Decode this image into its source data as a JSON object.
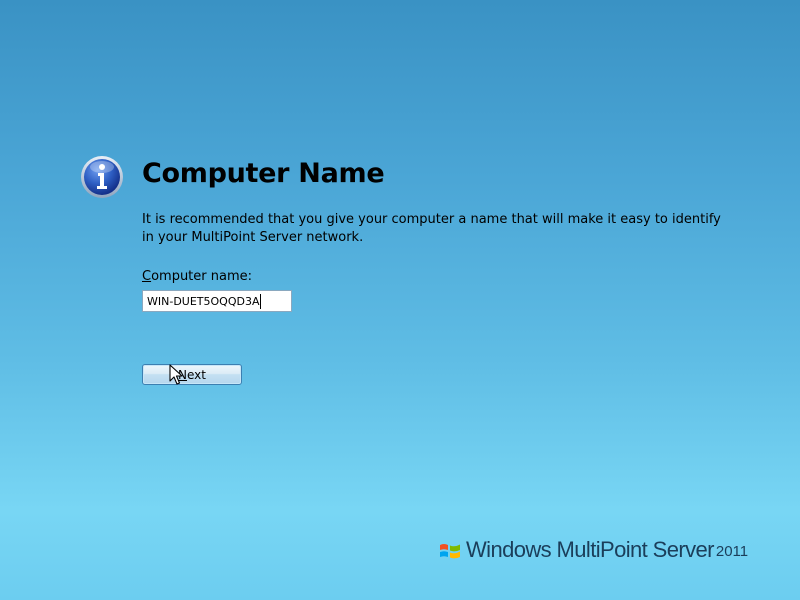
{
  "header": {
    "title": "Computer Name",
    "icon": "info-icon"
  },
  "description": "It is recommended that you give your computer a name that will make it easy to identify in your MultiPoint Server network.",
  "form": {
    "label_mnemonic": "C",
    "label_rest": "omputer name:",
    "computer_name_value": "WIN-DUET5OQQD3A"
  },
  "buttons": {
    "next_mnemonic": "N",
    "next_rest": "ext"
  },
  "branding": {
    "product": "Windows MultiPoint Server",
    "year": "2011",
    "logo_icon": "windows-flag-icon"
  },
  "colors": {
    "background_top": "#3a92c4",
    "background_bottom": "#78d6f4",
    "brand_text": "#1b3e5a"
  }
}
